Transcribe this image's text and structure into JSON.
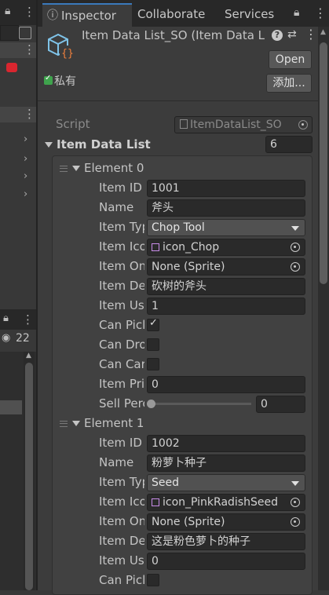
{
  "tabs": {
    "inspector": "Inspector",
    "collaborate": "Collaborate",
    "services": "Services"
  },
  "left_panel": {
    "count": "22"
  },
  "header": {
    "title": "Item Data List_SO (Item Data L",
    "open_label": "Open",
    "add_label": "添加...",
    "private_label": "私有"
  },
  "script_row": {
    "label": "Script",
    "value": "ItemDataList_SO"
  },
  "list": {
    "label": "Item Data List",
    "size": "6"
  },
  "elements": [
    {
      "title": "Element 0",
      "id_label": "Item ID",
      "id": "1001",
      "name_label": "Name",
      "name": "斧头",
      "type_label": "Item Typ",
      "type": "Chop Tool",
      "icon_label": "Item Ico",
      "icon": "icon_Chop",
      "onworld_label": "Item On",
      "onworld": "None (Sprite)",
      "desc_label": "Item Des",
      "desc": "砍树的斧头",
      "use_label": "Item Use",
      "use": "1",
      "canpick_label": "Can Picl",
      "canpick": true,
      "candrop_label": "Can Dro",
      "candrop": false,
      "cancarry_label": "Can Car",
      "cancarry": false,
      "price_label": "Item Pric",
      "price": "0",
      "sell_label": "Sell Perc",
      "sell": "0"
    },
    {
      "title": "Element 1",
      "id_label": "Item ID",
      "id": "1002",
      "name_label": "Name",
      "name": "粉萝卜种子",
      "type_label": "Item Typ",
      "type": "Seed",
      "icon_label": "Item Ico",
      "icon": "icon_PinkRadishSeed",
      "onworld_label": "Item On",
      "onworld": "None (Sprite)",
      "desc_label": "Item Des",
      "desc": "这是粉色萝卜的种子",
      "use_label": "Item Use",
      "use": "0",
      "canpick_label": "Can Picl",
      "canpick": false
    }
  ],
  "colors": {
    "accent": "#3a79bb",
    "checkbox_green": "#3fa34d",
    "error_red": "#d9262f"
  }
}
